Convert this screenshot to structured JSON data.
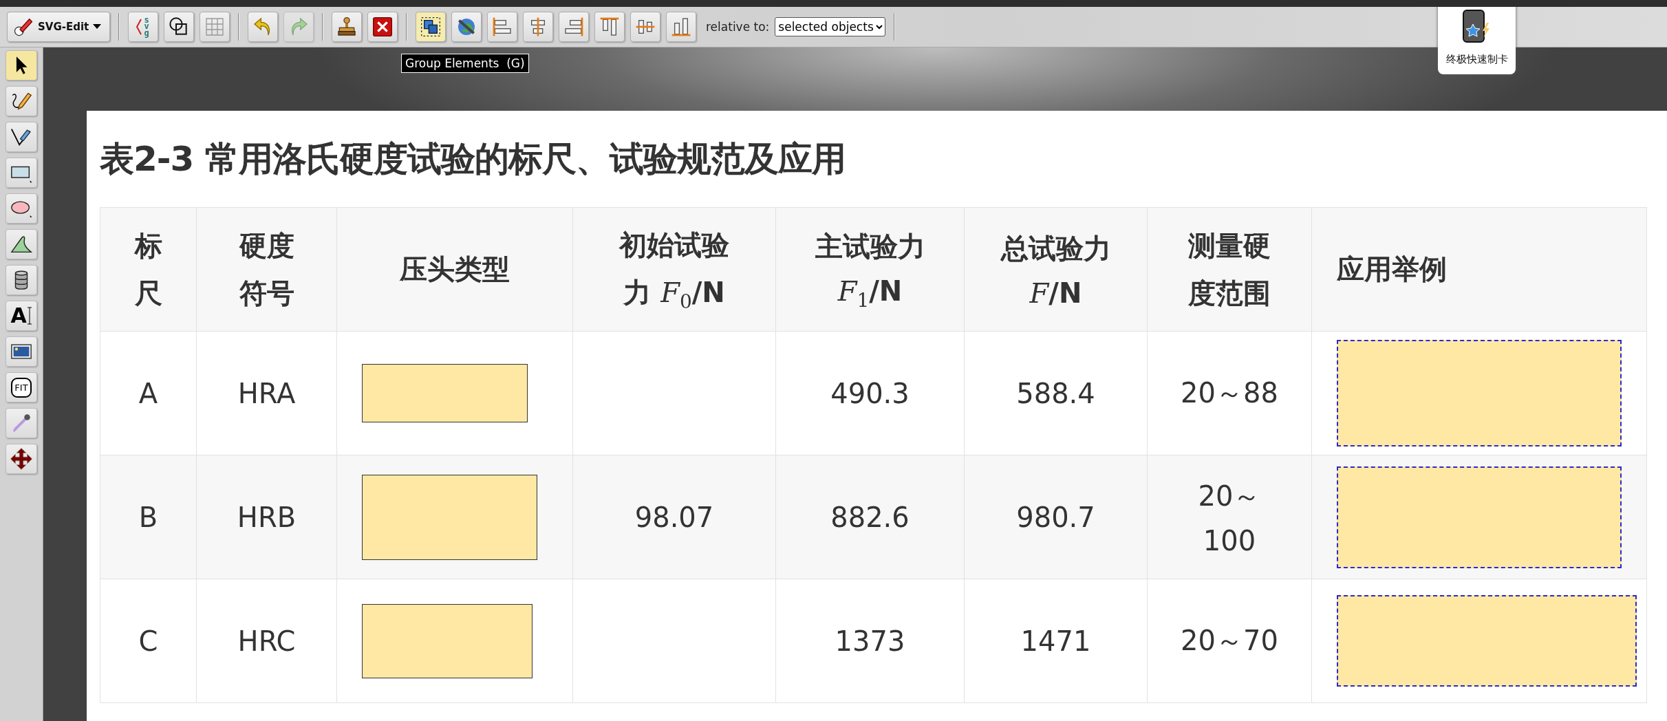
{
  "toolbar": {
    "menu_label": "SVG-Edit",
    "groups": [
      [
        {
          "kind": "source",
          "label": "svg",
          "selected": false,
          "disabled": false
        },
        {
          "kind": "wireframe",
          "selected": false,
          "disabled": false
        },
        {
          "kind": "grid",
          "selected": false,
          "disabled": false
        }
      ],
      [
        {
          "kind": "undo",
          "selected": false,
          "disabled": false
        },
        {
          "kind": "redo",
          "selected": false,
          "disabled": true
        }
      ],
      [
        {
          "kind": "import",
          "selected": false,
          "disabled": false
        },
        {
          "kind": "delete",
          "selected": false,
          "disabled": false
        }
      ],
      [
        {
          "kind": "group",
          "selected": true,
          "disabled": false
        },
        {
          "kind": "link",
          "selected": false,
          "disabled": false
        },
        {
          "kind": "align-left",
          "selected": false,
          "disabled": false
        },
        {
          "kind": "align-center",
          "selected": false,
          "disabled": false
        },
        {
          "kind": "align-right",
          "selected": false,
          "disabled": false
        },
        {
          "kind": "align-top",
          "selected": false,
          "disabled": false
        },
        {
          "kind": "align-middle",
          "selected": false,
          "disabled": false
        },
        {
          "kind": "align-bottom",
          "selected": false,
          "disabled": false
        }
      ]
    ],
    "relative_label": "relative to:",
    "relative_value": "selected objects"
  },
  "tooltip": "Group Elements  (G)",
  "popup": {
    "label": "终极快速制卡"
  },
  "tools": [
    {
      "kind": "select",
      "selected": true
    },
    {
      "kind": "pencil",
      "selected": false
    },
    {
      "kind": "pen",
      "selected": false
    },
    {
      "kind": "rect",
      "selected": false
    },
    {
      "kind": "ellipse",
      "selected": false
    },
    {
      "kind": "path",
      "selected": false
    },
    {
      "kind": "shapes",
      "selected": false
    },
    {
      "kind": "text",
      "label": "A",
      "selected": false
    },
    {
      "kind": "image",
      "selected": false
    },
    {
      "kind": "zoom",
      "label": "FIT",
      "selected": false
    },
    {
      "kind": "eyedropper",
      "selected": false
    },
    {
      "kind": "move",
      "selected": false
    }
  ],
  "document": {
    "title": "表2-3 常用洛氏硬度试验的标尺、试验规范及应用",
    "table": {
      "columns": [
        {
          "lines": [
            "标",
            "尺"
          ]
        },
        {
          "lines": [
            "硬度",
            "符号"
          ]
        },
        {
          "lines": [
            "压头类型"
          ]
        },
        {
          "lines": [
            "初始试验",
            "力 *F*$_{0}$/N"
          ]
        },
        {
          "lines": [
            "主试验力",
            "*F*$_{1}$/N"
          ]
        },
        {
          "lines": [
            "总试验力",
            "*F*/N"
          ]
        },
        {
          "lines": [
            "测量硬",
            "度范围"
          ]
        },
        {
          "lines": [
            "应用举例"
          ]
        }
      ],
      "rows": [
        {
          "cells": [
            {
              "kind": "text",
              "lines": [
                "A"
              ]
            },
            {
              "kind": "text",
              "lines": [
                "HRA"
              ]
            },
            {
              "kind": "shape",
              "selected": false
            },
            {
              "kind": "empty"
            },
            {
              "kind": "text",
              "lines": [
                "490.3"
              ]
            },
            {
              "kind": "text",
              "lines": [
                "588.4"
              ]
            },
            {
              "kind": "text",
              "lines": [
                "20～88"
              ]
            },
            {
              "kind": "shape",
              "selected": true
            }
          ]
        },
        {
          "cells": [
            {
              "kind": "text",
              "lines": [
                "B"
              ]
            },
            {
              "kind": "text",
              "lines": [
                "HRB"
              ]
            },
            {
              "kind": "shape",
              "selected": false
            },
            {
              "kind": "text",
              "lines": [
                "98.07"
              ]
            },
            {
              "kind": "text",
              "lines": [
                "882.6"
              ]
            },
            {
              "kind": "text",
              "lines": [
                "980.7"
              ]
            },
            {
              "kind": "text",
              "lines": [
                "20～",
                "100"
              ]
            },
            {
              "kind": "shape",
              "selected": true
            }
          ]
        },
        {
          "cells": [
            {
              "kind": "text",
              "lines": [
                "C"
              ]
            },
            {
              "kind": "text",
              "lines": [
                "HRC"
              ]
            },
            {
              "kind": "shape",
              "selected": false
            },
            {
              "kind": "empty"
            },
            {
              "kind": "text",
              "lines": [
                "1373"
              ]
            },
            {
              "kind": "text",
              "lines": [
                "1471"
              ]
            },
            {
              "kind": "text",
              "lines": [
                "20～70"
              ]
            },
            {
              "kind": "shape",
              "selected": true
            }
          ]
        }
      ]
    }
  }
}
